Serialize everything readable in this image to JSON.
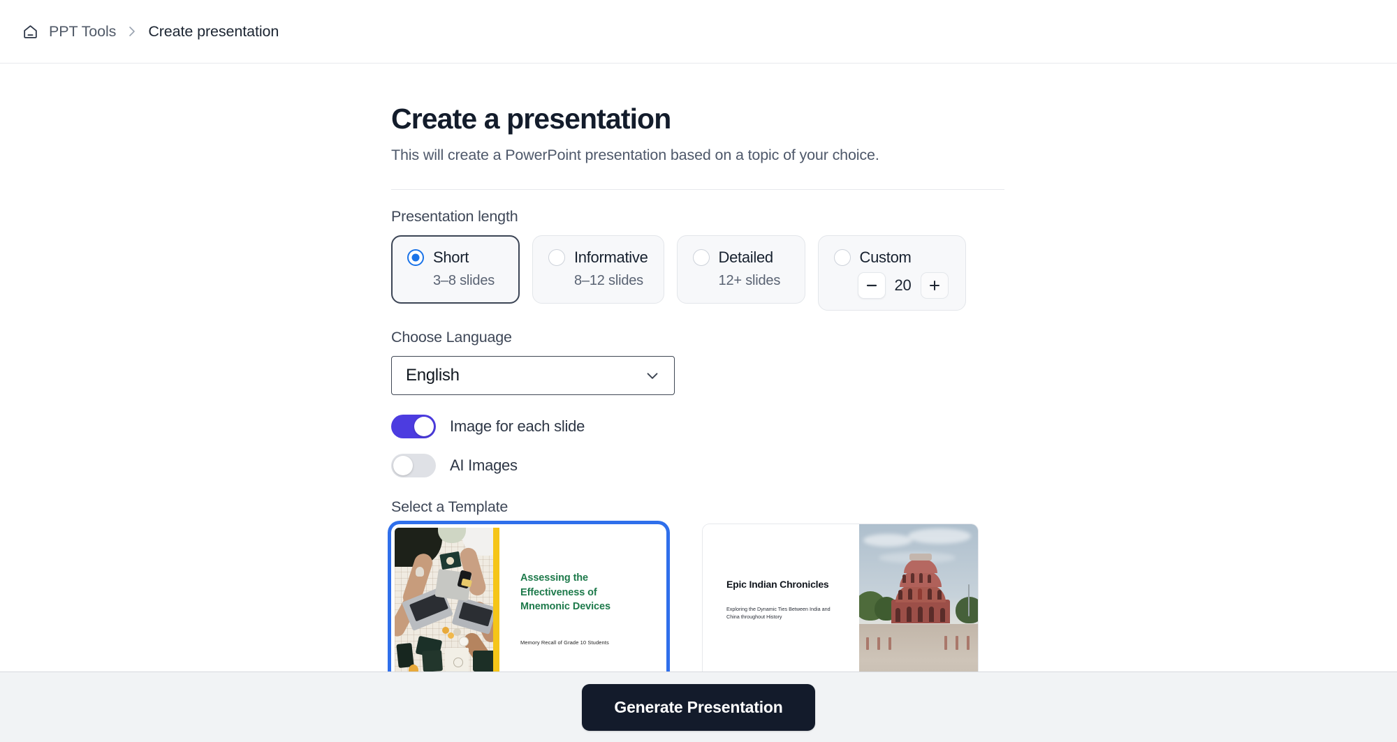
{
  "header": {
    "home_icon": "home-icon",
    "breadcrumb_root": "PPT Tools",
    "breadcrumb_separator": "›",
    "breadcrumb_current": "Create presentation"
  },
  "main": {
    "title": "Create a presentation",
    "subtitle": "This will create a PowerPoint presentation based on a topic of your choice."
  },
  "length": {
    "label": "Presentation length",
    "options": [
      {
        "name": "Short",
        "detail": "3–8 slides",
        "selected": true
      },
      {
        "name": "Informative",
        "detail": "8–12 slides",
        "selected": false
      },
      {
        "name": "Detailed",
        "detail": "12+ slides",
        "selected": false
      }
    ],
    "custom": {
      "name": "Custom",
      "selected": false,
      "decrement_label": "−",
      "value": "20",
      "increment_label": "+"
    }
  },
  "language": {
    "label": "Choose Language",
    "selected": "English",
    "chevron_icon": "chevron-down-icon"
  },
  "toggles": [
    {
      "label": "Image for each slide",
      "state": "on"
    },
    {
      "label": "AI Images",
      "state": "off"
    }
  ],
  "templates": {
    "label": "Select a Template",
    "items": [
      {
        "title": "Assessing the Effectiveness of Mnemonic Devices",
        "subtitle": "Memory Recall of Grade 10 Students",
        "selected": true
      },
      {
        "title": "Epic Indian Chronicles",
        "subtitle": "Exploring the Dynamic Ties Between India and China throughout History",
        "selected": false
      }
    ]
  },
  "footer": {
    "generate_label": "Generate Presentation"
  },
  "colors": {
    "accent_toggle_on": "#4C3CE0",
    "accent_radio_selected": "#1A73E8",
    "template_selected_border": "#2F6FEB",
    "generate_button_bg": "#131B2B",
    "template_a_title": "#1E7A4B"
  }
}
